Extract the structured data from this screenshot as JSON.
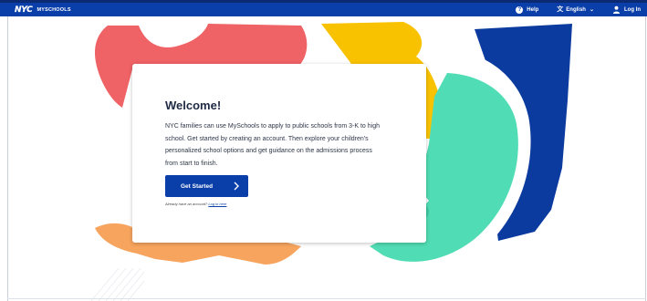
{
  "header": {
    "logo_nyc": "NYC",
    "logo_app": "MYSCHOOLS",
    "help_label": "Help",
    "language_label": "English",
    "login_label": "Log In"
  },
  "icons": {
    "help": "question-circle-icon",
    "language": "translate-icon",
    "dropdown": "chevron-down-icon",
    "login": "user-icon",
    "cta": "chevron-right-icon"
  },
  "card": {
    "title": "Welcome!",
    "lines": [
      "NYC families can use MySchools to apply to public schools from 3-K to high",
      "school. Get started by creating an account. Then explore your children's",
      "personalized school options and get guidance on the admissions process",
      "from start to finish."
    ],
    "cta_label": "Get Started",
    "already_text": "Already have an account?",
    "login_link": "Log in here"
  },
  "colors": {
    "brand_blue": "#0a3ea8",
    "red_shape": "#ef6265",
    "yellow_shape": "#f9c201",
    "green_shape": "#50dcb4",
    "navy_shape": "#0b3b9f",
    "orange_shape": "#f7a45e"
  }
}
